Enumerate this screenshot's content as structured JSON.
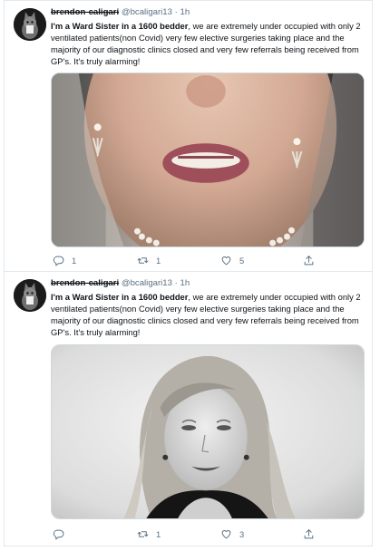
{
  "tweets": [
    {
      "author_name": "brendon-caligari",
      "handle": "@bcaligari13",
      "separator": "·",
      "time": "1h",
      "text_bold": "I'm a Ward Sister in a 1600 bedder",
      "text_rest": ", we are extremely under occupied with only 2 ventilated patients(non Covid) very few elective surgeries taking place and the majority of our diagnostic clinics closed and very few referrals being received from GP's. It's truly alarming!",
      "replies": "1",
      "retweets": "1",
      "likes": "5",
      "reply_count_visible": true
    },
    {
      "author_name": "brendon-caligari",
      "handle": "@bcaligari13",
      "separator": "·",
      "time": "1h",
      "text_bold": "I'm a Ward Sister in a 1600 bedder",
      "text_rest": ", we are extremely under occupied with only 2 ventilated patients(non Covid) very few elective surgeries taking place and the majority of our diagnostic clinics closed and very few referrals being received from GP's. It's truly alarming!",
      "replies": "",
      "retweets": "1",
      "likes": "3",
      "reply_count_visible": false
    }
  ],
  "icons": {
    "reply": "reply-icon",
    "retweet": "retweet-icon",
    "like": "heart-icon",
    "share": "share-icon"
  },
  "colors": {
    "secondary_text": "#5b7083",
    "border": "#e1e8ed"
  }
}
